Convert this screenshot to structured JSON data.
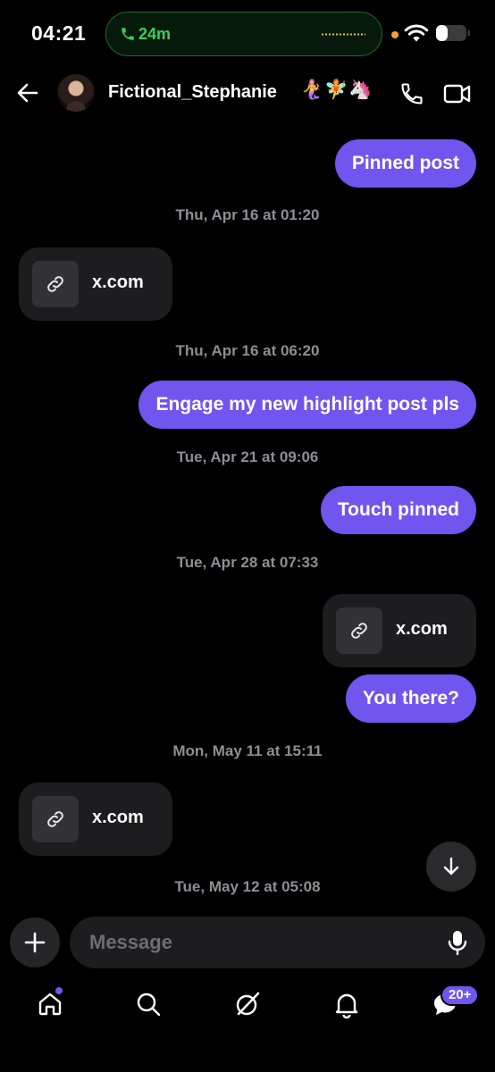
{
  "status_bar": {
    "time": "04:21",
    "call_duration": "24m",
    "icons": [
      "phone-icon",
      "wifi-icon",
      "battery-icon"
    ]
  },
  "header": {
    "contact_name": "Fictional_Stephanie",
    "contact_emojis": "🧜‍♀️🧚🦄",
    "icons": [
      "back-arrow-icon",
      "phone-icon",
      "video-icon"
    ]
  },
  "conversation": {
    "messages": [
      {
        "type": "sent",
        "text": "Pinned post"
      },
      {
        "type": "timestamp",
        "text": "Thu, Apr 16 at 01:20"
      },
      {
        "type": "received-link",
        "text": "x.com"
      },
      {
        "type": "timestamp",
        "text": "Thu, Apr 16 at 06:20"
      },
      {
        "type": "sent",
        "text": "Engage my new highlight post pls"
      },
      {
        "type": "timestamp",
        "text": "Tue, Apr 21 at 09:06"
      },
      {
        "type": "sent",
        "text": "Touch pinned"
      },
      {
        "type": "timestamp",
        "text": "Tue, Apr 28 at 07:33"
      },
      {
        "type": "sent-link",
        "text": "x.com"
      },
      {
        "type": "sent",
        "text": "You there?"
      },
      {
        "type": "timestamp",
        "text": "Mon, May 11 at 15:11"
      },
      {
        "type": "received-link",
        "text": "x.com"
      },
      {
        "type": "timestamp",
        "text": "Tue, May 12 at 05:08"
      }
    ]
  },
  "composer": {
    "placeholder": "Message"
  },
  "bottom_nav": {
    "items": [
      "home-icon",
      "search-icon",
      "grok-icon",
      "notifications-icon",
      "messages-icon"
    ],
    "messages_badge": "20+"
  },
  "colors": {
    "accent": "#7056ee",
    "background": "#000000",
    "received_bubble": "#1d1d1f",
    "timestamp": "#8e8e93",
    "call_green": "#35d05a"
  }
}
